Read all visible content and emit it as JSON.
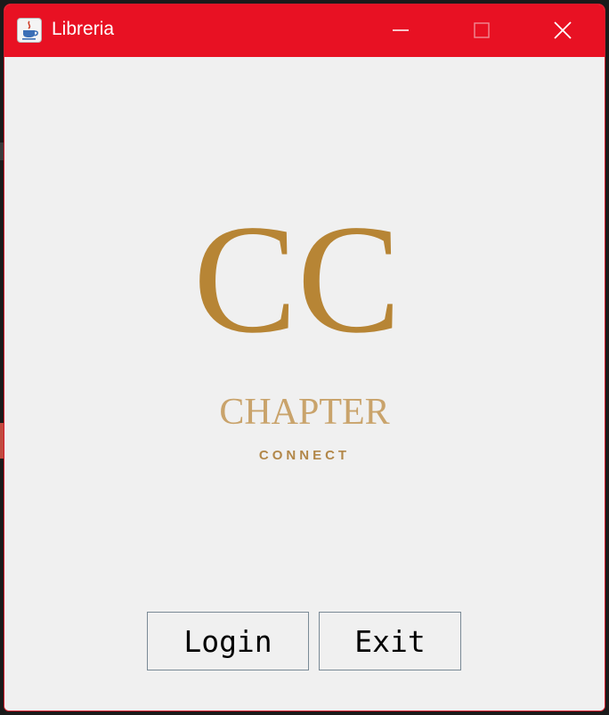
{
  "window": {
    "title": "Libreria",
    "icon": "java-coffee-cup-icon",
    "controls": [
      "minimize-icon",
      "maximize-icon",
      "close-icon"
    ],
    "titlebar_color": "#e81123"
  },
  "logo": {
    "monogram": "CC",
    "name": "CHAPTER",
    "tagline": "CONNECT",
    "color": "#b78535"
  },
  "buttons": {
    "login_label": "Login",
    "exit_label": "Exit"
  }
}
